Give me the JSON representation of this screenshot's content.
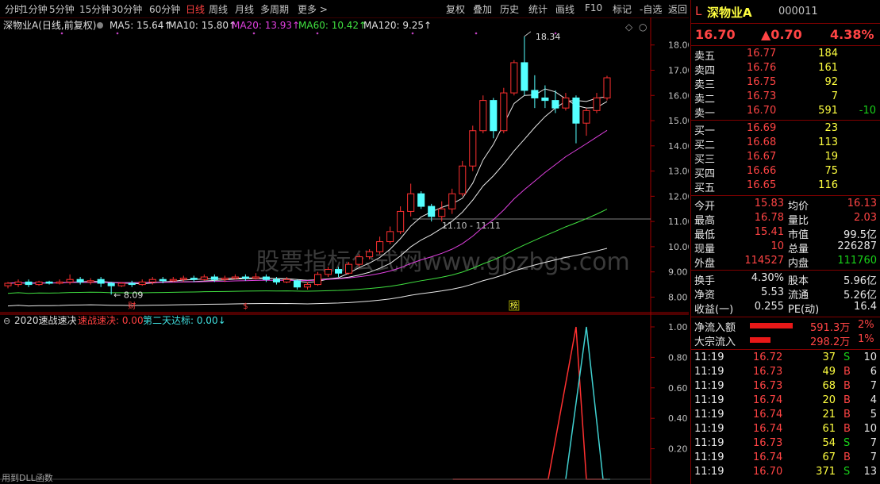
{
  "toolbar": {
    "left": [
      "分时",
      "1分钟",
      "5分钟",
      "15分钟",
      "30分钟",
      "60分钟",
      "日线",
      "周线",
      "月线",
      "多周期",
      "更多 >"
    ],
    "active": "日线",
    "right": [
      "复权",
      "叠加",
      "历史",
      "统计",
      "画线",
      "F10",
      "标记",
      "-自选",
      "返回"
    ]
  },
  "main_chart": {
    "title": "深物业A(日线,前复权)",
    "ma_labels": [
      {
        "text": "MA5: 15.64↑",
        "color": "#e0e0e0"
      },
      {
        "text": "MA10: 15.80↑",
        "color": "#e0e0e0"
      },
      {
        "text": "MA20: 13.93↑",
        "color": "#e040e0"
      },
      {
        "text": "MA60: 10.42↑",
        "color": "#40e040"
      },
      {
        "text": "MA120: 9.25↑",
        "color": "#e0e0e0"
      }
    ],
    "y_ticks": [
      "18.00",
      "17.00",
      "16.00",
      "15.00",
      "14.00",
      "13.00",
      "12.00",
      "11.00",
      "10.00",
      "9.00",
      "8.00"
    ],
    "high_label": "18.34",
    "low_label": "8.09",
    "range_label": "11.10 - 11.11",
    "watermark": "股票指标公式网www.gpzbgs.com",
    "event_markers": [
      "财",
      "$",
      "榜"
    ],
    "candles": [
      [
        8.45,
        8.55,
        8.35,
        8.6
      ],
      [
        8.5,
        8.6,
        8.4,
        8.7
      ],
      [
        8.6,
        8.5,
        8.4,
        8.7
      ],
      [
        8.5,
        8.6,
        8.45,
        8.65
      ],
      [
        8.6,
        8.55,
        8.5,
        8.65
      ],
      [
        8.55,
        8.6,
        8.5,
        8.7
      ],
      [
        8.6,
        8.7,
        8.5,
        8.9
      ],
      [
        8.7,
        8.6,
        8.5,
        8.8
      ],
      [
        8.6,
        8.65,
        8.5,
        8.75
      ],
      [
        8.7,
        8.55,
        8.4,
        8.8
      ],
      [
        8.55,
        8.45,
        8.1,
        8.6
      ],
      [
        8.45,
        8.55,
        8.4,
        8.6
      ],
      [
        8.55,
        8.5,
        8.4,
        8.65
      ],
      [
        8.5,
        8.6,
        8.45,
        8.7
      ],
      [
        8.6,
        8.7,
        8.5,
        8.8
      ],
      [
        8.7,
        8.65,
        8.55,
        8.8
      ],
      [
        8.65,
        8.7,
        8.6,
        8.8
      ],
      [
        8.7,
        8.75,
        8.6,
        8.85
      ],
      [
        8.75,
        8.7,
        8.6,
        8.85
      ],
      [
        8.7,
        8.8,
        8.65,
        8.9
      ],
      [
        8.8,
        8.7,
        8.6,
        8.9
      ],
      [
        8.7,
        8.75,
        8.6,
        8.85
      ],
      [
        8.75,
        8.8,
        8.7,
        8.9
      ],
      [
        8.8,
        8.75,
        8.65,
        8.9
      ],
      [
        8.75,
        8.8,
        8.7,
        8.95
      ],
      [
        8.8,
        8.7,
        8.6,
        8.9
      ],
      [
        8.7,
        8.6,
        8.5,
        8.8
      ],
      [
        8.6,
        8.7,
        8.55,
        8.8
      ],
      [
        8.65,
        8.4,
        8.3,
        8.7
      ],
      [
        8.4,
        8.5,
        8.3,
        8.6
      ],
      [
        8.5,
        8.9,
        8.45,
        9.0
      ],
      [
        8.9,
        9.1,
        8.8,
        9.2
      ],
      [
        9.1,
        8.95,
        8.8,
        9.2
      ],
      [
        8.95,
        9.3,
        8.9,
        9.4
      ],
      [
        9.3,
        9.6,
        9.2,
        9.7
      ],
      [
        9.6,
        9.8,
        9.5,
        9.9
      ],
      [
        9.8,
        10.2,
        9.7,
        10.4
      ],
      [
        10.2,
        10.6,
        10.1,
        10.8
      ],
      [
        10.6,
        11.4,
        10.5,
        11.6
      ],
      [
        11.4,
        12.1,
        11.2,
        12.5
      ],
      [
        12.1,
        11.6,
        11.5,
        12.2
      ],
      [
        11.6,
        11.2,
        11.0,
        11.7
      ],
      [
        11.2,
        11.5,
        11.0,
        11.8
      ],
      [
        11.5,
        12.1,
        11.3,
        12.3
      ],
      [
        12.1,
        13.2,
        12.0,
        13.4
      ],
      [
        13.2,
        14.6,
        13.0,
        14.8
      ],
      [
        14.6,
        15.8,
        14.5,
        16.0
      ],
      [
        15.8,
        14.6,
        14.3,
        15.9
      ],
      [
        14.6,
        16.1,
        14.5,
        16.3
      ],
      [
        16.1,
        17.3,
        16.0,
        17.4
      ],
      [
        17.3,
        16.2,
        16.0,
        18.34
      ],
      [
        16.2,
        15.9,
        15.5,
        16.8
      ],
      [
        15.9,
        15.8,
        15.5,
        16.4
      ],
      [
        15.8,
        15.5,
        15.3,
        16.2
      ],
      [
        15.5,
        15.9,
        15.4,
        16.1
      ],
      [
        15.9,
        14.9,
        14.1,
        16.0
      ],
      [
        14.9,
        15.4,
        14.4,
        15.5
      ],
      [
        15.4,
        15.9,
        15.3,
        16.1
      ],
      [
        15.9,
        16.7,
        15.8,
        16.78
      ]
    ]
  },
  "indicator": {
    "title": "2020速战速决",
    "label1": "速战速决: 0.00",
    "label2": "第二天达标: 0.00↓",
    "y_ticks": [
      "1.00",
      "0.80",
      "0.60",
      "0.40",
      "0.20"
    ],
    "footer": "用到DLL函数"
  },
  "quote": {
    "prefix": "L",
    "name": "深物业A",
    "code": "000011",
    "price": "16.70",
    "change": "▲0.70",
    "pct": "4.38%",
    "asks": [
      {
        "label": "卖五",
        "price": "16.77",
        "vol": "184",
        "chg": ""
      },
      {
        "label": "卖四",
        "price": "16.76",
        "vol": "161",
        "chg": ""
      },
      {
        "label": "卖三",
        "price": "16.75",
        "vol": "92",
        "chg": ""
      },
      {
        "label": "卖二",
        "price": "16.73",
        "vol": "7",
        "chg": ""
      },
      {
        "label": "卖一",
        "price": "16.70",
        "vol": "591",
        "chg": "-10"
      }
    ],
    "bids": [
      {
        "label": "买一",
        "price": "16.69",
        "vol": "23"
      },
      {
        "label": "买二",
        "price": "16.68",
        "vol": "113"
      },
      {
        "label": "买三",
        "price": "16.67",
        "vol": "19"
      },
      {
        "label": "买四",
        "price": "16.66",
        "vol": "75"
      },
      {
        "label": "买五",
        "price": "16.65",
        "vol": "116"
      }
    ],
    "stats1": [
      {
        "l1": "今开",
        "v1": "15.83",
        "c1": "red",
        "l2": "均价",
        "v2": "16.13",
        "c2": "red"
      },
      {
        "l1": "最高",
        "v1": "16.78",
        "c1": "red",
        "l2": "量比",
        "v2": "2.03",
        "c2": "red"
      },
      {
        "l1": "最低",
        "v1": "15.41",
        "c1": "red",
        "l2": "市值",
        "v2": "99.5亿",
        "c2": "white"
      },
      {
        "l1": "现量",
        "v1": "10",
        "c1": "red",
        "l2": "总量",
        "v2": "226287",
        "c2": "white"
      },
      {
        "l1": "外盘",
        "v1": "114527",
        "c1": "red",
        "l2": "内盘",
        "v2": "111760",
        "c2": "green"
      }
    ],
    "stats2": [
      {
        "l1": "换手",
        "v1": "4.30%",
        "l2": "股本",
        "v2": "5.96亿"
      },
      {
        "l1": "净资",
        "v1": "5.53",
        "l2": "流通",
        "v2": "5.26亿"
      },
      {
        "l1": "收益(一)",
        "v1": "0.255",
        "l2": "PE(动)",
        "v2": "16.4"
      }
    ],
    "flows": [
      {
        "label": "净流入额",
        "value": "591.3万",
        "pct": "2%",
        "level": 0.85
      },
      {
        "label": "大宗流入",
        "value": "298.2万",
        "pct": "1%",
        "level": 0.4
      }
    ],
    "ticks": [
      {
        "time": "11:19",
        "price": "16.72",
        "vol": "37",
        "side": "S",
        "n": "10"
      },
      {
        "time": "11:19",
        "price": "16.73",
        "vol": "49",
        "side": "B",
        "n": "6"
      },
      {
        "time": "11:19",
        "price": "16.73",
        "vol": "68",
        "side": "B",
        "n": "7"
      },
      {
        "time": "11:19",
        "price": "16.74",
        "vol": "20",
        "side": "B",
        "n": "4"
      },
      {
        "time": "11:19",
        "price": "16.74",
        "vol": "21",
        "side": "B",
        "n": "5"
      },
      {
        "time": "11:19",
        "price": "16.74",
        "vol": "61",
        "side": "B",
        "n": "10"
      },
      {
        "time": "11:19",
        "price": "16.73",
        "vol": "54",
        "side": "S",
        "n": "7"
      },
      {
        "time": "11:19",
        "price": "16.74",
        "vol": "67",
        "side": "B",
        "n": "7"
      },
      {
        "time": "11:19",
        "price": "16.70",
        "vol": "371",
        "side": "S",
        "n": "13"
      }
    ]
  },
  "colors": {
    "up": "#ff3030",
    "down": "#54ffff",
    "border": "#a00000"
  }
}
